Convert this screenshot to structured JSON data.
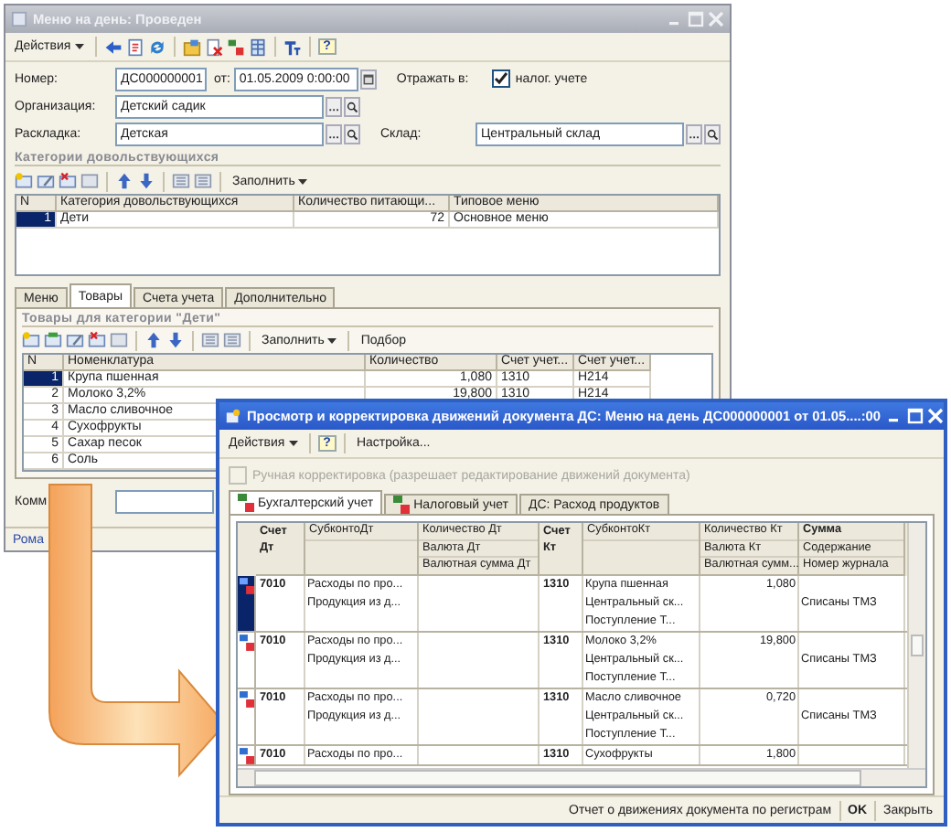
{
  "doc_window": {
    "title": "Меню на день: Проведен",
    "active": false,
    "toolbar": {
      "actions": "Действия",
      "help": "?"
    },
    "fields": {
      "number_label": "Номер:",
      "number": "ДС000000001",
      "date_label": "от:",
      "date": "01.05.2009  0:00:00",
      "reflect_label": "Отражать в:",
      "tax_checkbox": {
        "label": "налог. учете",
        "checked": true
      },
      "org_label": "Организация:",
      "org": "Детский садик",
      "layout_label": "Раскладка:",
      "layout": "Детская",
      "warehouse_label": "Склад:",
      "warehouse": "Центральный склад"
    },
    "categories": {
      "title": "Категории довольствующихся",
      "fill": "Заполнить",
      "columns": [
        "N",
        "Категория довольствующихся",
        "Количество питающи...",
        "Типовое меню"
      ],
      "rows": [
        {
          "cells": [
            "1",
            "Дети",
            "72",
            "Основное меню"
          ],
          "selected": true
        }
      ]
    },
    "tabs": [
      {
        "label": "Меню",
        "selected": false
      },
      {
        "label": "Товары",
        "selected": true
      },
      {
        "label": "Счета учета",
        "selected": false
      },
      {
        "label": "Дополнительно",
        "selected": false
      }
    ],
    "goods": {
      "title": "Товары для категории \"Дети\"",
      "fill": "Заполнить",
      "pick": "Подбор",
      "columns": [
        "N",
        "Номенклатура",
        "Количество",
        "Счет учет...",
        "Счет учет..."
      ],
      "rows": [
        {
          "cells": [
            "1",
            "Крупа пшенная",
            "1,080",
            "1310",
            "Н214"
          ],
          "selected": true
        },
        {
          "cells": [
            "2",
            "Молоко 3,2%",
            "19,800",
            "1310",
            "Н214"
          ],
          "selected": false
        },
        {
          "cells": [
            "3",
            "Масло сливочное"
          ],
          "selected": false
        },
        {
          "cells": [
            "4",
            "Сухофрукты"
          ],
          "selected": false
        },
        {
          "cells": [
            "5",
            "Сахар песок"
          ],
          "selected": false
        },
        {
          "cells": [
            "6",
            "Соль"
          ],
          "selected": false
        }
      ]
    },
    "comment_label": "Комм",
    "status": "Рома"
  },
  "moves_window": {
    "title": "Просмотр и корректировка движений документа ДС: Меню на день ДС000000001 от 01.05....:00",
    "active": true,
    "toolbar": {
      "actions": "Действия",
      "help": "?",
      "settings": "Настройка..."
    },
    "manual": {
      "label": "Ручная корректировка (разрешает редактирование движений документа)",
      "checked": false,
      "disabled": true
    },
    "tabs": [
      {
        "label": "Бухгалтерский учет",
        "selected": true,
        "kind": "icon"
      },
      {
        "label": "Налоговый учет",
        "selected": false,
        "kind": "icon"
      },
      {
        "label": "ДС: Расход продуктов",
        "selected": false,
        "kind": "plain"
      }
    ],
    "columns": [
      {
        "kind": "account",
        "lines": [
          "Счет Дт"
        ]
      },
      {
        "kind": "stack",
        "lines": [
          "СубконтоДт"
        ],
        "bold": false
      },
      {
        "kind": "stack",
        "lines": [
          "Количество Дт",
          "Валюта Дт",
          "Валютная сумма Дт"
        ],
        "bold": false
      },
      {
        "kind": "account",
        "lines": [
          "Счет",
          "Кт"
        ]
      },
      {
        "kind": "stack",
        "lines": [
          "СубконтоКт"
        ],
        "bold": false
      },
      {
        "kind": "stack",
        "lines": [
          "Количество Кт",
          "Валюта Кт",
          "Валютная сумм..."
        ],
        "bold": false
      },
      {
        "kind": "stack",
        "lines": [
          "Сумма",
          "Содержание",
          "Номер журнала"
        ],
        "bold": true
      }
    ],
    "entries": [
      {
        "selected": true,
        "account_dt": "7010",
        "subconto_dt": [
          "Расходы по про...",
          "Продукция из д..."
        ],
        "account_kt": "1310",
        "subconto_kt": [
          "Крупа пшенная",
          "Центральный ск...",
          "Поступление Т..."
        ],
        "qty_kt": "1,080",
        "content": "Списаны ТМЗ"
      },
      {
        "selected": false,
        "account_dt": "7010",
        "subconto_dt": [
          "Расходы по про...",
          "Продукция из д..."
        ],
        "account_kt": "1310",
        "subconto_kt": [
          "Молоко 3,2%",
          "Центральный ск...",
          "Поступление Т..."
        ],
        "qty_kt": "19,800",
        "content": "Списаны ТМЗ"
      },
      {
        "selected": false,
        "account_dt": "7010",
        "subconto_dt": [
          "Расходы по про...",
          "Продукция из д..."
        ],
        "account_kt": "1310",
        "subconto_kt": [
          "Масло сливочное",
          "Центральный ск...",
          "Поступление Т..."
        ],
        "qty_kt": "0,720",
        "content": "Списаны ТМЗ"
      },
      {
        "selected": false,
        "account_dt": "7010",
        "subconto_dt": [
          "Расходы по про..."
        ],
        "account_kt": "1310",
        "subconto_kt": [
          "Сухофрукты"
        ],
        "qty_kt": "1,800"
      }
    ],
    "footer": {
      "report": "Отчет о движениях документа по регистрам",
      "ok": "OK",
      "close": "Закрыть"
    }
  }
}
